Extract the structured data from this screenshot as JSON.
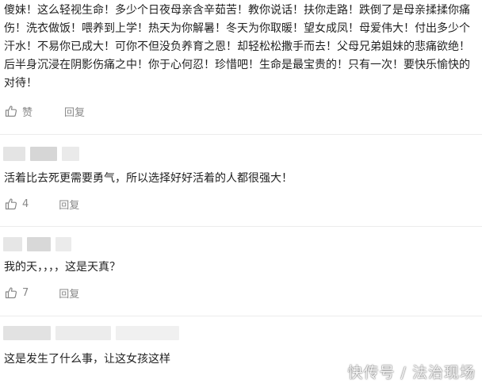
{
  "comments": [
    {
      "text": "傻妹！这么轻视生命！多少个日夜母亲含辛茹苦！教你说话！扶你走路！跌倒了是母亲揉揉你痛伤！洗衣做饭！喂养到上学！热天为你解暑！冬天为你取暖！望女成凤！母爱伟大！付出多少个汗水！不易你已成大！可你不但没负养育之恩！却轻松松撒手而去！父母兄弟姐妹的悲痛欲绝！后半身沉浸在阴影伤痛之中！你于心何忍！珍惜吧！生命是最宝贵的！只有一次！要快乐愉快的对待！",
      "like_label": "赞",
      "reply_label": "回复"
    },
    {
      "text": "活着比去死更需要勇气，所以选择好好活着的人都很强大！",
      "like_label": "4",
      "reply_label": "回复"
    },
    {
      "text": "我的天，，，，这是天真？",
      "like_label": "7",
      "reply_label": "回复"
    },
    {
      "text": "这是发生了什么事，让这女孩这样"
    }
  ],
  "watermark": "快传号 / 法治现场",
  "colors": {
    "text": "#222222",
    "meta": "#888888",
    "divider": "#ececec",
    "blur": "#d9d9d9"
  }
}
